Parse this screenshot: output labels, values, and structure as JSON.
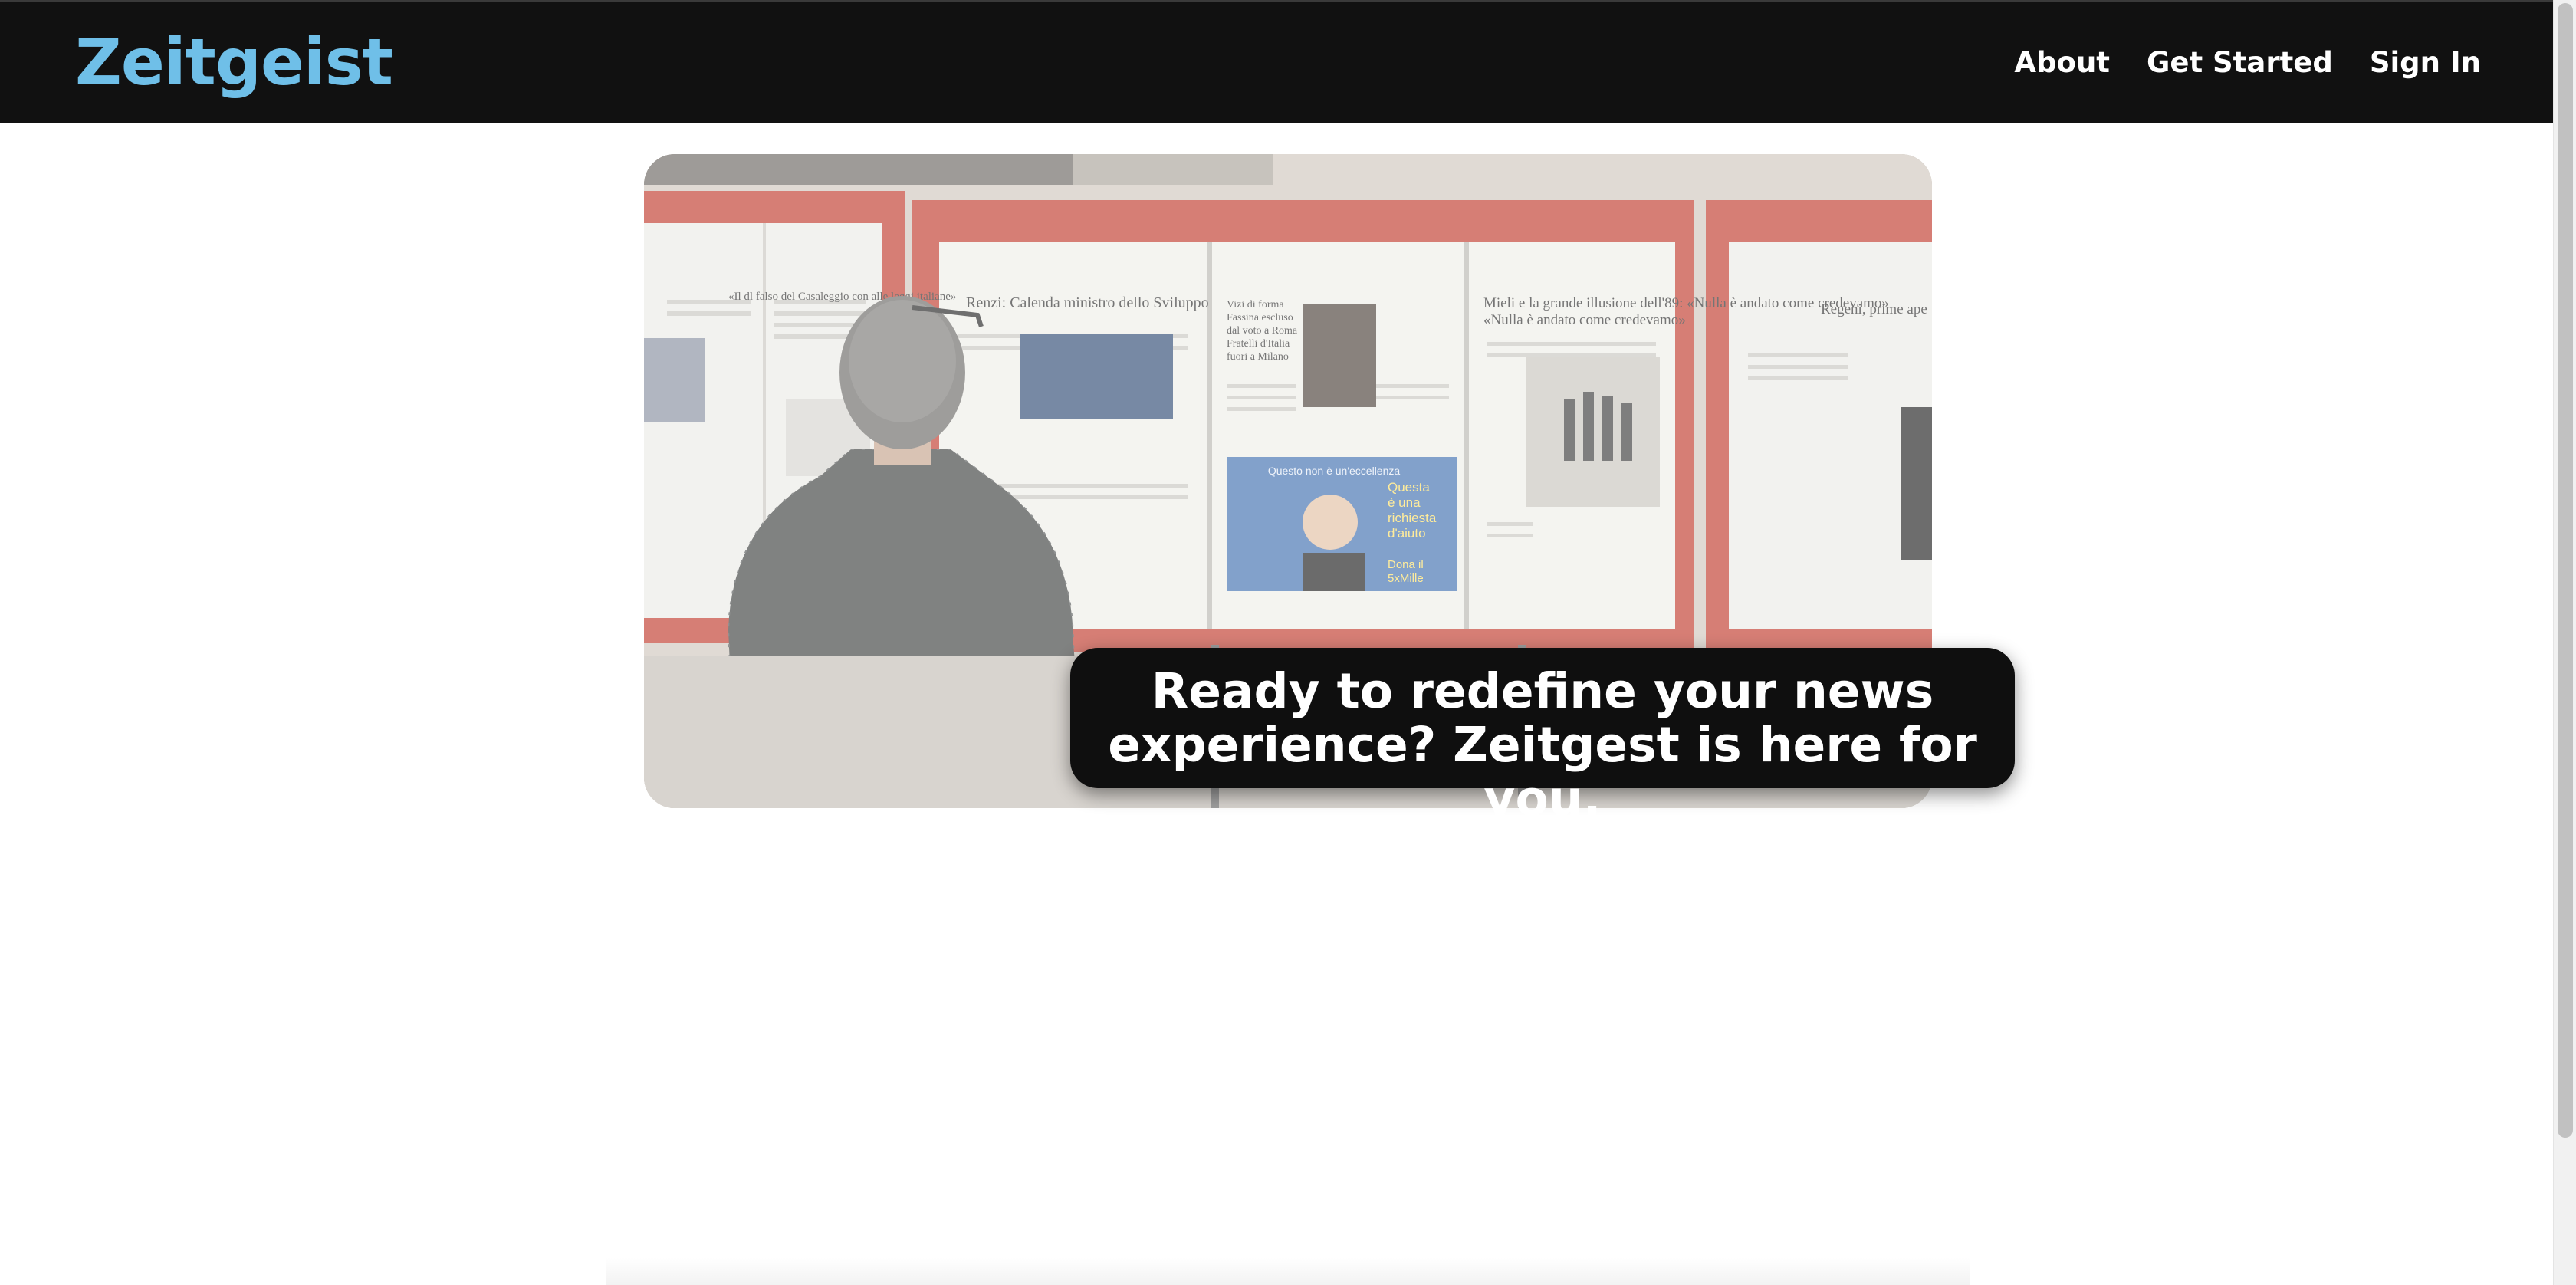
{
  "header": {
    "logo": "Zeitgeist",
    "nav": [
      {
        "label": "About"
      },
      {
        "label": "Get Started"
      },
      {
        "label": "Sign In"
      }
    ]
  },
  "hero": {
    "image_alt": "Man in a checked jacket reading newspapers posted in red display boards",
    "newspaper_headlines": [
      "«Il dl falso del Casaleggio con alle leggi italiane»",
      "Renzi: Calenda ministro dello Sviluppo",
      "Vizi di forma Fassina escluso dal voto a Roma Fratelli d'Italia fuori a Milano",
      "Mieli e la grande illusione dell'89: «Nulla è andato come credevamo»",
      "Regeni, prime ape",
      "Questo non è un'eccellenza",
      "Questa è una richiesta d'aiuto",
      "Dona il 5xMille"
    ],
    "caption": "Ready to redefine your news experience? Zeitgest is here for you."
  },
  "colors": {
    "navbar_bg": "#111111",
    "logo": "#6fbfe8",
    "board_frame": "#c0392b",
    "caption_bg": "#0f0f0f"
  }
}
